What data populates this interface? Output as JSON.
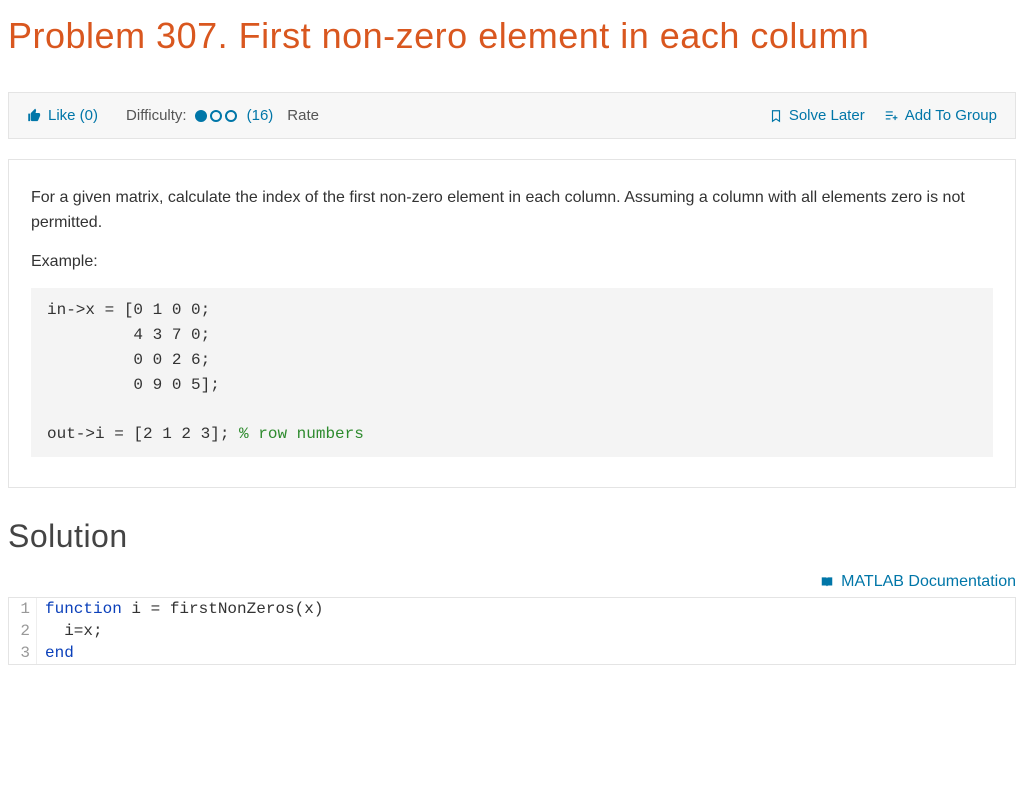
{
  "title": "Problem 307. First non-zero element in each column",
  "toolbar": {
    "like_label": "Like (0)",
    "difficulty_label": "Difficulty:",
    "difficulty_count": "(16)",
    "rate_label": "Rate",
    "solve_later_label": "Solve Later",
    "add_group_label": "Add To Group"
  },
  "description": {
    "para1": "For a given matrix, calculate the index of the first non-zero element in each column. Assuming a column with all elements zero is not permitted.",
    "example_label": "Example:",
    "code_in": "in->x = [0 1 0 0;\n         4 3 7 0;\n         0 0 2 6;\n         0 9 0 5];\n",
    "code_out_prefix": "out->i = [2 1 2 3]; ",
    "code_out_comment": "% row numbers"
  },
  "solution_heading": "Solution",
  "doc_link_label": "MATLAB Documentation",
  "editor": {
    "lines": [
      {
        "n": "1",
        "pre": "",
        "kw": "function",
        "rest": " i = firstNonZeros(x)"
      },
      {
        "n": "2",
        "pre": "  i=x;",
        "kw": "",
        "rest": ""
      },
      {
        "n": "3",
        "pre": "",
        "kw": "end",
        "rest": ""
      }
    ]
  }
}
